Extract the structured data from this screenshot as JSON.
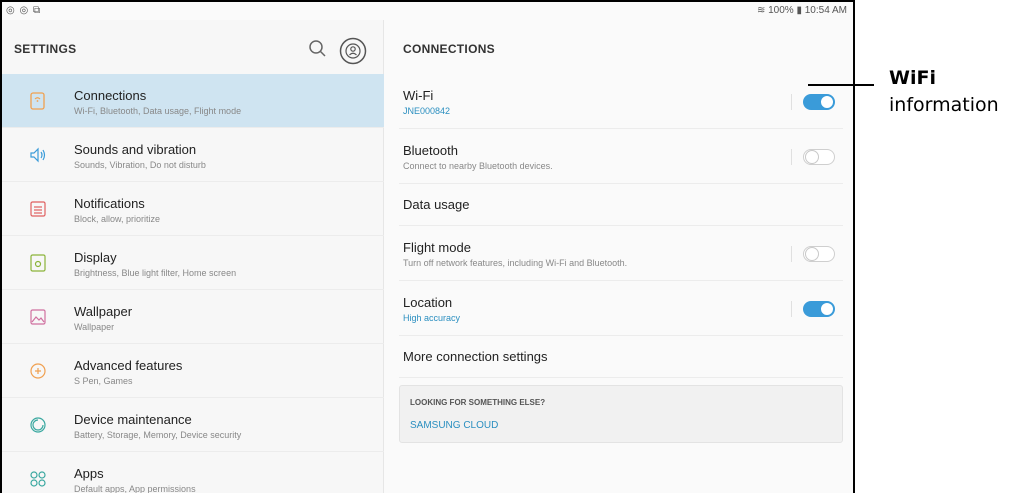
{
  "status_bar": {
    "left_icons": "◎ ◎ ⧉",
    "right_text": "≋ 100% ▮ 10:54 AM"
  },
  "left": {
    "title": "SETTINGS",
    "items": [
      {
        "title": "Connections",
        "sub": "Wi-Fi, Bluetooth, Data usage, Flight mode",
        "icon": "connections-icon",
        "active": true
      },
      {
        "title": "Sounds and vibration",
        "sub": "Sounds, Vibration, Do not disturb",
        "icon": "sound-icon"
      },
      {
        "title": "Notifications",
        "sub": "Block, allow, prioritize",
        "icon": "notifications-icon"
      },
      {
        "title": "Display",
        "sub": "Brightness, Blue light filter, Home screen",
        "icon": "display-icon"
      },
      {
        "title": "Wallpaper",
        "sub": "Wallpaper",
        "icon": "wallpaper-icon"
      },
      {
        "title": "Advanced features",
        "sub": "S Pen, Games",
        "icon": "advanced-icon"
      },
      {
        "title": "Device maintenance",
        "sub": "Battery, Storage, Memory, Device security",
        "icon": "maintenance-icon"
      },
      {
        "title": "Apps",
        "sub": "Default apps, App permissions",
        "icon": "apps-icon"
      }
    ]
  },
  "right": {
    "title": "CONNECTIONS",
    "rows": [
      {
        "title": "Wi-Fi",
        "sub": "JNE000842",
        "sub_blue": true,
        "toggle": "on"
      },
      {
        "title": "Bluetooth",
        "sub": "Connect to nearby Bluetooth devices.",
        "toggle": "off"
      },
      {
        "title": "Data usage"
      },
      {
        "title": "Flight mode",
        "sub": "Turn off network features, including Wi-Fi and Bluetooth.",
        "toggle": "off"
      },
      {
        "title": "Location",
        "sub": "High accuracy",
        "sub_blue": true,
        "toggle": "on"
      },
      {
        "title": "More connection settings"
      }
    ],
    "looking_title": "LOOKING FOR SOMETHING ELSE?",
    "looking_link": "SAMSUNG CLOUD"
  },
  "callout": {
    "title": "WiFi",
    "sub": "information"
  },
  "colors": {
    "accent": "#3a9bd9",
    "active_bg": "#cfe4f1",
    "icon_orange": "#f0a050",
    "icon_teal": "#3aa8a0"
  }
}
